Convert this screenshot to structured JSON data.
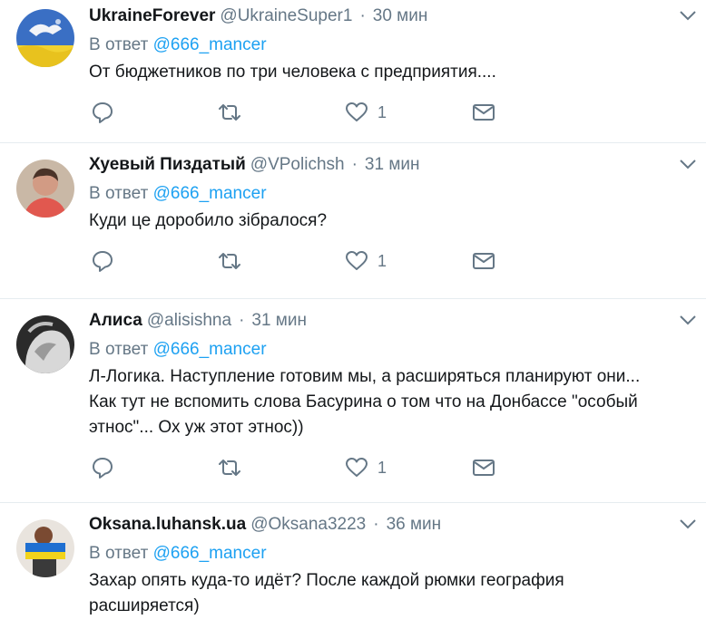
{
  "tweets": [
    {
      "name": "UkraineForever",
      "screen_name": "@UkraineSuper1",
      "dot": "·",
      "time": "30 мин",
      "reply_prefix": "В ответ",
      "reply_handle": "@666_mancer",
      "text_lines": [
        "От бюджетников по три человека с предприятия...."
      ],
      "like_count": "1"
    },
    {
      "name": "Хуевый Пиздатый",
      "screen_name": "@VPolichsh",
      "dot": "·",
      "time": "31 мин",
      "reply_prefix": "В ответ",
      "reply_handle": "@666_mancer",
      "text_lines": [
        "Куди це доробило зібралося?"
      ],
      "like_count": "1"
    },
    {
      "name": "Алиса",
      "screen_name": "@alisishna",
      "dot": "·",
      "time": "31 мин",
      "reply_prefix": "В ответ",
      "reply_handle": "@666_mancer",
      "text_lines": [
        "Л-Логика. Наступление готовим мы, а расширяться планируют они...",
        "Как тут не вспомить слова Басурина о том что на Донбассе \"особый",
        "этнос\"... Ох уж этот этнос))"
      ],
      "like_count": "1"
    },
    {
      "name": "Oksana.luhansk.ua",
      "screen_name": "@Oksana3223",
      "dot": "·",
      "time": "36 мин",
      "reply_prefix": "В ответ",
      "reply_handle": "@666_mancer",
      "text_lines": [
        "Захар опять куда-то идёт? После каждой рюмки география",
        "расширяется)"
      ],
      "like_count": ""
    }
  ],
  "icons": {
    "reply": "reply-icon",
    "retweet": "retweet-icon",
    "like": "heart-icon",
    "dm": "envelope-icon",
    "caret": "chevron-down-icon"
  },
  "colors": {
    "link": "#1da1f2",
    "muted": "#657786",
    "text": "#14171a",
    "divider": "#e6ecf0"
  }
}
